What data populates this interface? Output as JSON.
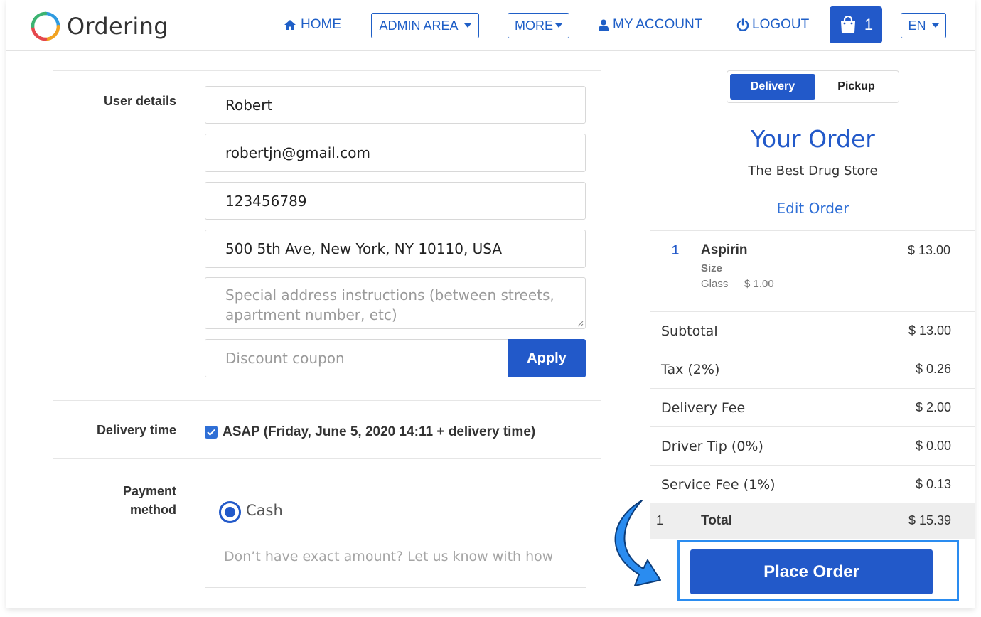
{
  "app": {
    "title": "Ordering"
  },
  "nav": {
    "home": "HOME",
    "admin_area": "ADMIN AREA",
    "more": "MORE",
    "my_account": "MY ACCOUNT",
    "logout": "LOGOUT",
    "cart_count": "1",
    "language": "EN"
  },
  "user_details": {
    "label": "User details",
    "name": "Robert",
    "email": "robertjn@gmail.com",
    "phone": "123456789",
    "address": "500 5th Ave, New York, NY 10110, USA",
    "instructions_placeholder": "Special address instructions (between streets, apartment number, etc)",
    "coupon_placeholder": "Discount coupon",
    "apply_label": "Apply"
  },
  "delivery_time": {
    "label": "Delivery time",
    "asap_text": "ASAP (Friday, June 5, 2020 14:11 + delivery time)",
    "checked": true
  },
  "payment": {
    "label_line1": "Payment",
    "label_line2": "method",
    "cash_label": "Cash",
    "exact_amount_placeholder": "Don’t have exact amount? Let us know with how much you will pay"
  },
  "order": {
    "toggle_delivery": "Delivery",
    "toggle_pickup": "Pickup",
    "title": "Your Order",
    "store": "The Best Drug Store",
    "edit_label": "Edit Order",
    "items": [
      {
        "qty": "1",
        "name": "Aspirin",
        "price": "$ 13.00",
        "option_label": "Size",
        "option_value": "Glass",
        "option_price": "$ 1.00"
      }
    ],
    "summary": [
      {
        "label": "Subtotal",
        "value": "$ 13.00"
      },
      {
        "label": "Tax (2%)",
        "value": "$ 0.26"
      },
      {
        "label": "Delivery Fee",
        "value": "$ 2.00"
      },
      {
        "label": "Driver Tip (0%)",
        "value": "$ 0.00"
      },
      {
        "label": "Service Fee (1%)",
        "value": "$ 0.13"
      }
    ],
    "total": {
      "qty": "1",
      "label": "Total",
      "value": "$ 15.39"
    },
    "place_order_label": "Place Order"
  },
  "colors": {
    "primary": "#2259c9",
    "link": "#1f5fc7",
    "highlight": "#2a8cf0"
  }
}
